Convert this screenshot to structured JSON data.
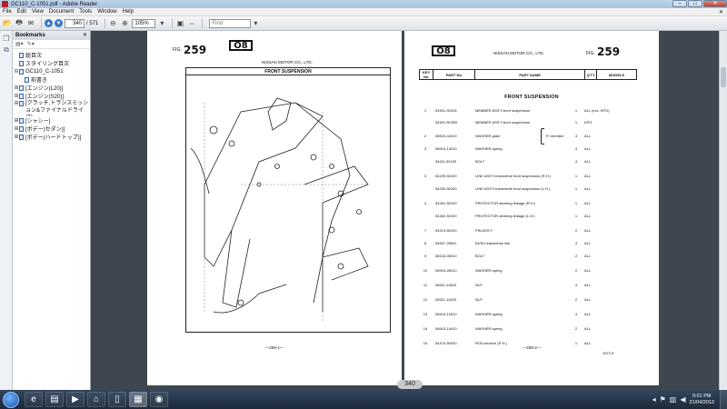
{
  "window": {
    "title": "GC110_C-1051.pdf - Adobe Reader",
    "buttons": {
      "minimize": "–",
      "maximize": "□",
      "close": "✕"
    }
  },
  "menu": {
    "items": [
      "File",
      "Edit",
      "View",
      "Document",
      "Tools",
      "Window",
      "Help"
    ],
    "close": "✕"
  },
  "toolbar": {
    "page_current": "340",
    "page_total": "/ 571",
    "zoom": "105%",
    "find_placeholder": "Find"
  },
  "bookmarks": {
    "header": "Bookmarks",
    "close": "✕",
    "tools": [
      "▤▾",
      "✎▾"
    ],
    "items": [
      {
        "label": "総目次",
        "level": 0,
        "expandable": false
      },
      {
        "label": "スタイリング目次",
        "level": 0,
        "expandable": false
      },
      {
        "label": "GC110_C-1051",
        "level": 0,
        "expandable": true
      },
      {
        "label": "前書き",
        "level": 1,
        "expandable": false
      },
      {
        "label": "[エンジン(L20)]",
        "level": 0,
        "expandable": true
      },
      {
        "label": "[エンジン(S20)]",
        "level": 0,
        "expandable": true
      },
      {
        "label": "[クラッチ,トランスミッション&ファイナルドライブ]",
        "level": 0,
        "expandable": true
      },
      {
        "label": "[シャシー]",
        "level": 0,
        "expandable": true
      },
      {
        "label": "[ボデー(セダン)]",
        "level": 0,
        "expandable": true
      },
      {
        "label": "[ボデー(ハードトップ)]",
        "level": 0,
        "expandable": true
      }
    ]
  },
  "page_left": {
    "no_label": "FIG.",
    "fig_number": "259",
    "group": "O8",
    "maker": "NISSAN MOTOR CO., LTD.",
    "caption": "FRONT SUSPENSION",
    "footer": "—259-1—"
  },
  "page_right": {
    "group": "O8",
    "maker": "NISSAN MOTOR CO., LTD.",
    "no_label": "FIG.",
    "fig_number": "259",
    "headers": {
      "key": "KEY No.",
      "part_no": "PART No.",
      "part_name": "PART NAME",
      "qty": "Q'TY",
      "models": "MODELS"
    },
    "section": "FRONT SUSPENSION",
    "brace_label": "Fr member",
    "footer": "—259-2—",
    "date": "1972.5",
    "rows": [
      {
        "key": "1",
        "part_no": "54401-S0401",
        "name": "MEMBER ASS'Y-front suspension",
        "qty": "1",
        "models": "ALL (exc. KPG)"
      },
      {
        "key": "",
        "part_no": "54401-R0300",
        "name": "MEMBER ASS'Y-front suspension",
        "qty": "1",
        "models": "KPG"
      },
      {
        "key": "2",
        "part_no": "08915-44010",
        "name": "WASHER-plain",
        "qty": "4",
        "models": "ALL"
      },
      {
        "key": "3",
        "part_no": "08915-14010",
        "name": "WASHER-spring",
        "qty": "4",
        "models": "ALL"
      },
      {
        "key": "",
        "part_no": "54411-50100",
        "name": "BOLT",
        "qty": "4",
        "models": "ALL"
      },
      {
        "key": "3",
        "part_no": "54229-50100",
        "name": "LINK ASS'Y-transverse front suspension (R.H.)",
        "qty": "1",
        "models": "ALL"
      },
      {
        "key": "",
        "part_no": "54230-50100",
        "name": "LINK ASS'Y-transverse front suspension (L.H.)",
        "qty": "1",
        "models": "ALL"
      },
      {
        "key": "4",
        "part_no": "54451-50100",
        "name": "PROTECTOR-steering linkage (R.H.)",
        "qty": "1",
        "models": "ALL"
      },
      {
        "key": "",
        "part_no": "54452-50100",
        "name": "PROTECTOR-steering linkage (L.H.)",
        "qty": "1",
        "models": "ALL"
      },
      {
        "key": "7",
        "part_no": "54219-80100",
        "name": "PIN ASS'Y",
        "qty": "2",
        "models": "ALL"
      },
      {
        "key": "8",
        "part_no": "54537-26501",
        "name": "BUSH-transverse link",
        "qty": "4",
        "models": "ALL"
      },
      {
        "key": "9",
        "part_no": "08134-05010",
        "name": "BOLT",
        "qty": "2",
        "models": "ALL"
      },
      {
        "key": "10",
        "part_no": "08915-26010",
        "name": "WASHER-spring",
        "qty": "2",
        "models": "ALL"
      },
      {
        "key": "11",
        "part_no": "08911-10610",
        "name": "NUT",
        "qty": "4",
        "models": "ALL"
      },
      {
        "key": "12",
        "part_no": "08911-14010",
        "name": "NUT",
        "qty": "2",
        "models": "ALL"
      },
      {
        "key": "13",
        "part_no": "08915-12610",
        "name": "WASHER-spring",
        "qty": "4",
        "models": "ALL"
      },
      {
        "key": "14",
        "part_no": "08915-14010",
        "name": "WASHER-spring",
        "qty": "2",
        "models": "ALL"
      },
      {
        "key": "15",
        "part_no": "54470-80000",
        "name": "ROD-tension (R.H.)",
        "qty": "1",
        "models": "ALL"
      }
    ]
  },
  "page_badge": "340",
  "taskbar": {
    "time": "9:01 PM",
    "date": "21/04/2013"
  },
  "colors": {
    "doc_background": "#3f4650",
    "taskbar": "#1c2a3b",
    "accent": "#3b78c8"
  }
}
